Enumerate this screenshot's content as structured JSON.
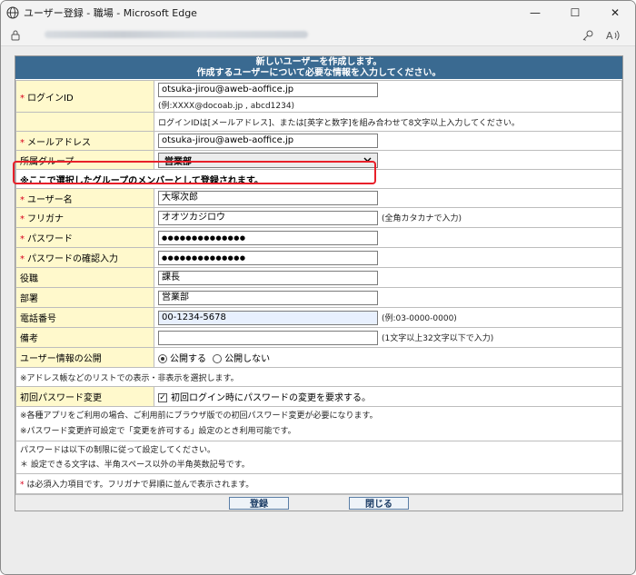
{
  "window": {
    "title": "ユーザー登録 - 職場 - Microsoft Edge",
    "minimize": "—",
    "maximize": "☐",
    "close": "✕"
  },
  "header": {
    "line1": "新しいユーザーを作成します。",
    "line2": "作成するユーザーについて必要な情報を入力してください。"
  },
  "required_mark": "*",
  "fields": {
    "login_id": {
      "label": "ログインID",
      "value": "otsuka-jirou@aweb-aoffice.jp",
      "example": "(例:XXXX@docoab.jp , abcd1234)"
    },
    "login_rule": "ログインIDは[メールアドレス]、または[英字と数字]を組み合わせて8文字以上入力してください。",
    "email": {
      "label": "メールアドレス",
      "value": "otsuka-jirou@aweb-aoffice.jp"
    },
    "group": {
      "label": "所属グループ",
      "value": "営業部"
    },
    "group_note": "※ここで選択したグループのメンバーとして登録されます。",
    "user_name": {
      "label": "ユーザー名",
      "value": "大塚次郎"
    },
    "furigana": {
      "label": "フリガナ",
      "value": "オオツカジロウ",
      "help": "(全角カタカナで入力)"
    },
    "password": {
      "label": "パスワード",
      "value": "●●●●●●●●●●●●●●"
    },
    "password_confirm": {
      "label": "パスワードの確認入力",
      "value": "●●●●●●●●●●●●●●"
    },
    "position": {
      "label": "役職",
      "value": "課長"
    },
    "department": {
      "label": "部署",
      "value": "営業部"
    },
    "phone": {
      "label": "電話番号",
      "value": "00-1234-5678",
      "help": "(例:03-0000-0000)"
    },
    "remarks": {
      "label": "備考",
      "value": "",
      "help": "(1文字以上32文字以下で入力)"
    },
    "publish": {
      "label": "ユーザー情報の公開",
      "option_public": "公開する",
      "option_private": "公開しない"
    },
    "publish_note": "※アドレス帳などのリストでの表示・非表示を選択します。",
    "initial_pw": {
      "label": "初回パスワード変更",
      "checkbox_label": "初回ログイン時にパスワードの変更を要求する。"
    },
    "initial_pw_note1": "※各種アプリをご利用の場合、ご利用前にブラウザ版での初回パスワード変更が必要になります。",
    "initial_pw_note2": "※パスワード変更許可設定で「変更を許可する」設定のとき利用可能です。",
    "pw_rule1": "パスワードは以下の制限に従って設定してください。",
    "pw_rule2": "設定できる文字は、半角スペース以外の半角英数記号です。",
    "required_note": "は必須入力項目です。フリガナで昇順に並んで表示されます。"
  },
  "buttons": {
    "register": "登録",
    "close": "閉じる"
  }
}
